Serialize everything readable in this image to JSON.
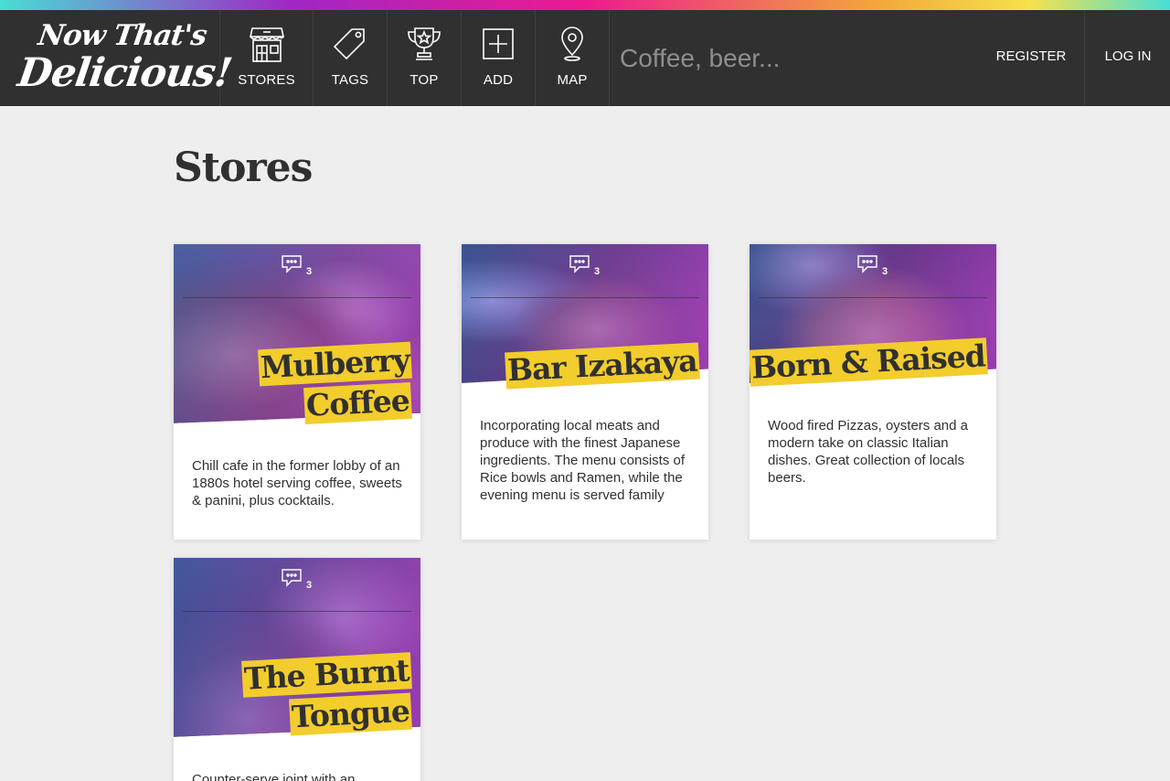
{
  "header": {
    "logo_line1": "Now That's",
    "logo_line2": "Delicious!",
    "nav": [
      {
        "label": "STORES",
        "icon": "store-icon"
      },
      {
        "label": "TAGS",
        "icon": "tag-icon"
      },
      {
        "label": "TOP",
        "icon": "trophy-icon"
      },
      {
        "label": "ADD",
        "icon": "add-icon"
      },
      {
        "label": "MAP",
        "icon": "map-pin-icon"
      }
    ],
    "search_placeholder": "Coffee, beer...",
    "register_label": "REGISTER",
    "login_label": "LOG IN"
  },
  "page": {
    "title": "Stores"
  },
  "stores": [
    {
      "name_lines": [
        "Mulberry",
        "Coffee"
      ],
      "comment_count": "3",
      "description": "Chill cafe in the former lobby of an 1880s hotel serving coffee, sweets & panini, plus cocktails."
    },
    {
      "name_lines": [
        "Bar Izakaya"
      ],
      "comment_count": "3",
      "description": "Incorporating local meats and produce with the finest Japanese ingredients. The menu consists of Rice bowls and Ramen, while the evening menu is served family"
    },
    {
      "name_lines": [
        "Born & Raised"
      ],
      "comment_count": "3",
      "description": "Wood fired Pizzas, oysters and a modern take on classic Italian dishes. Great collection of locals beers."
    },
    {
      "name_lines": [
        "The Burnt",
        "Tongue"
      ],
      "comment_count": "3",
      "description": "Counter-serve joint with an"
    }
  ],
  "colors": {
    "nav_bg": "#303030",
    "page_bg": "#eeeeee",
    "title_highlight": "#f2cd2c",
    "text": "#303030"
  }
}
